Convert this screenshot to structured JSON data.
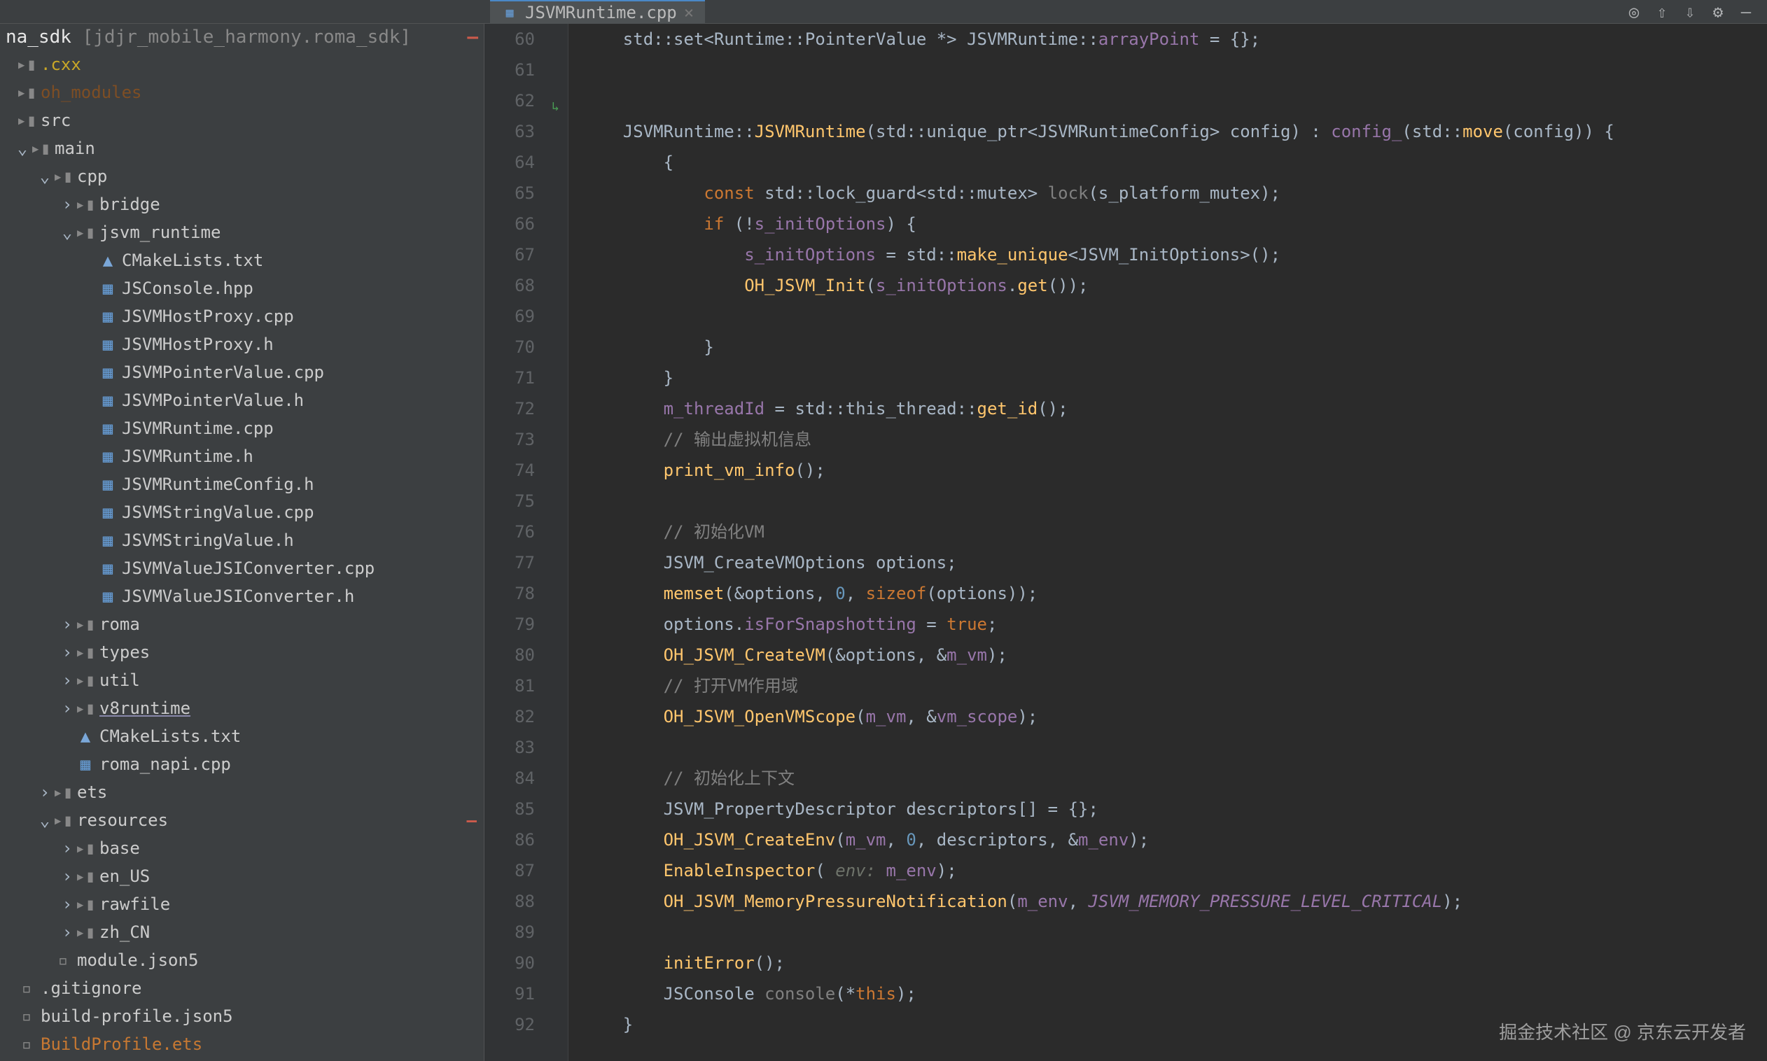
{
  "toolbar": {
    "icons": [
      "target-icon",
      "upload-icon",
      "download-icon",
      "gear-icon",
      "minimize-icon"
    ]
  },
  "tab": {
    "filename": "JSVMRuntime.cpp",
    "icon": "cpp-file-icon"
  },
  "project": {
    "module": "na_sdk",
    "path": "[jdjr_mobile_harmony.roma_sdk]"
  },
  "tree": [
    {
      "label": ".cxx",
      "indent": 0,
      "type": "folder-yellow"
    },
    {
      "label": "oh_modules",
      "indent": 0,
      "type": "folder-orange"
    },
    {
      "label": "src",
      "indent": 0,
      "type": "folder",
      "chevron": ""
    },
    {
      "label": "main",
      "indent": 1,
      "type": "folder",
      "chevron": "v"
    },
    {
      "label": "cpp",
      "indent": 2,
      "type": "folder",
      "chevron": "v"
    },
    {
      "label": "bridge",
      "indent": 3,
      "type": "folder",
      "chevron": ">"
    },
    {
      "label": "jsvm_runtime",
      "indent": 3,
      "type": "folder",
      "chevron": "v"
    },
    {
      "label": "CMakeLists.txt",
      "indent": 4,
      "type": "cmake"
    },
    {
      "label": "JSConsole.hpp",
      "indent": 4,
      "type": "cpp"
    },
    {
      "label": "JSVMHostProxy.cpp",
      "indent": 4,
      "type": "cpp"
    },
    {
      "label": "JSVMHostProxy.h",
      "indent": 4,
      "type": "cpp"
    },
    {
      "label": "JSVMPointerValue.cpp",
      "indent": 4,
      "type": "cpp"
    },
    {
      "label": "JSVMPointerValue.h",
      "indent": 4,
      "type": "cpp"
    },
    {
      "label": "JSVMRuntime.cpp",
      "indent": 4,
      "type": "cpp"
    },
    {
      "label": "JSVMRuntime.h",
      "indent": 4,
      "type": "cpp"
    },
    {
      "label": "JSVMRuntimeConfig.h",
      "indent": 4,
      "type": "cpp"
    },
    {
      "label": "JSVMStringValue.cpp",
      "indent": 4,
      "type": "cpp"
    },
    {
      "label": "JSVMStringValue.h",
      "indent": 4,
      "type": "cpp"
    },
    {
      "label": "JSVMValueJSIConverter.cpp",
      "indent": 4,
      "type": "cpp"
    },
    {
      "label": "JSVMValueJSIConverter.h",
      "indent": 4,
      "type": "cpp"
    },
    {
      "label": "roma",
      "indent": 3,
      "type": "folder",
      "chevron": ">"
    },
    {
      "label": "types",
      "indent": 3,
      "type": "folder",
      "chevron": ">"
    },
    {
      "label": "util",
      "indent": 3,
      "type": "folder",
      "chevron": ">"
    },
    {
      "label": "v8runtime",
      "indent": 3,
      "type": "folder",
      "chevron": ">",
      "v8": true
    },
    {
      "label": "CMakeLists.txt",
      "indent": 3,
      "type": "cmake"
    },
    {
      "label": "roma_napi.cpp",
      "indent": 3,
      "type": "cpp"
    },
    {
      "label": "ets",
      "indent": 2,
      "type": "folder",
      "chevron": ">"
    },
    {
      "label": "resources",
      "indent": 2,
      "type": "folder",
      "chevron": "v",
      "marker": true
    },
    {
      "label": "base",
      "indent": 3,
      "type": "folder",
      "chevron": ">"
    },
    {
      "label": "en_US",
      "indent": 3,
      "type": "folder",
      "chevron": ">"
    },
    {
      "label": "rawfile",
      "indent": 3,
      "type": "folder",
      "chevron": ">"
    },
    {
      "label": "zh_CN",
      "indent": 3,
      "type": "folder",
      "chevron": ">"
    },
    {
      "label": "module.json5",
      "indent": 2,
      "type": "json"
    },
    {
      "label": ".gitignore",
      "indent": 0,
      "type": "file"
    },
    {
      "label": "build-profile.json5",
      "indent": 0,
      "type": "file"
    },
    {
      "label": "BuildProfile.ets",
      "indent": 0,
      "type": "build-orange"
    }
  ],
  "gutter": {
    "start": 60,
    "end": 92
  },
  "code": [
    {
      "n": 60,
      "tokens": [
        {
          "t": "    std::set<Runtime::PointerValue *> JSVMRuntime::",
          "c": "ident"
        },
        {
          "t": "arrayPoint",
          "c": "field"
        },
        {
          "t": " = {};",
          "c": "punct"
        }
      ]
    },
    {
      "n": 61,
      "tokens": []
    },
    {
      "n": 62,
      "tokens": []
    },
    {
      "n": 63,
      "tokens": [
        {
          "t": "    JSVMRuntime::",
          "c": "ident"
        },
        {
          "t": "JSVMRuntime",
          "c": "func"
        },
        {
          "t": "(std::unique_ptr<JSVMRuntimeConfig> config) : ",
          "c": "ident"
        },
        {
          "t": "config_",
          "c": "field"
        },
        {
          "t": "(std::",
          "c": "ident"
        },
        {
          "t": "move",
          "c": "func"
        },
        {
          "t": "(config)) {",
          "c": "ident"
        }
      ]
    },
    {
      "n": 64,
      "tokens": [
        {
          "t": "        {",
          "c": "punct"
        }
      ]
    },
    {
      "n": 65,
      "tokens": [
        {
          "t": "            ",
          "c": "punct"
        },
        {
          "t": "const",
          "c": "kw"
        },
        {
          "t": " std::lock_guard<std::mutex> ",
          "c": "ident"
        },
        {
          "t": "lock",
          "c": "comment"
        },
        {
          "t": "(s_platform_mutex);",
          "c": "ident"
        }
      ]
    },
    {
      "n": 66,
      "tokens": [
        {
          "t": "            ",
          "c": "punct"
        },
        {
          "t": "if",
          "c": "kw"
        },
        {
          "t": " (!",
          "c": "ident"
        },
        {
          "t": "s_initOptions",
          "c": "field"
        },
        {
          "t": ") {",
          "c": "ident"
        }
      ]
    },
    {
      "n": 67,
      "tokens": [
        {
          "t": "                ",
          "c": "punct"
        },
        {
          "t": "s_initOptions",
          "c": "field"
        },
        {
          "t": " = std::",
          "c": "ident"
        },
        {
          "t": "make_unique",
          "c": "func"
        },
        {
          "t": "<JSVM_InitOptions>();",
          "c": "ident"
        }
      ]
    },
    {
      "n": 68,
      "tokens": [
        {
          "t": "                ",
          "c": "punct"
        },
        {
          "t": "OH_JSVM_Init",
          "c": "func"
        },
        {
          "t": "(",
          "c": "ident"
        },
        {
          "t": "s_initOptions",
          "c": "field"
        },
        {
          "t": ".",
          "c": "ident"
        },
        {
          "t": "get",
          "c": "func"
        },
        {
          "t": "());",
          "c": "ident"
        }
      ]
    },
    {
      "n": 69,
      "tokens": []
    },
    {
      "n": 70,
      "tokens": [
        {
          "t": "            }",
          "c": "punct"
        }
      ]
    },
    {
      "n": 71,
      "tokens": [
        {
          "t": "        }",
          "c": "punct"
        }
      ]
    },
    {
      "n": 72,
      "tokens": [
        {
          "t": "        ",
          "c": "punct"
        },
        {
          "t": "m_threadId",
          "c": "field"
        },
        {
          "t": " = std::this_thread::",
          "c": "ident"
        },
        {
          "t": "get_id",
          "c": "func"
        },
        {
          "t": "();",
          "c": "ident"
        }
      ]
    },
    {
      "n": 73,
      "tokens": [
        {
          "t": "        ",
          "c": "punct"
        },
        {
          "t": "// 输出虚拟机信息",
          "c": "comment"
        }
      ]
    },
    {
      "n": 74,
      "tokens": [
        {
          "t": "        ",
          "c": "punct"
        },
        {
          "t": "print_vm_info",
          "c": "func"
        },
        {
          "t": "();",
          "c": "ident"
        }
      ]
    },
    {
      "n": 75,
      "tokens": []
    },
    {
      "n": 76,
      "tokens": [
        {
          "t": "        ",
          "c": "punct"
        },
        {
          "t": "// 初始化VM",
          "c": "comment"
        }
      ]
    },
    {
      "n": 77,
      "tokens": [
        {
          "t": "        JSVM_CreateVMOptions options;",
          "c": "ident"
        }
      ]
    },
    {
      "n": 78,
      "tokens": [
        {
          "t": "        ",
          "c": "punct"
        },
        {
          "t": "memset",
          "c": "func"
        },
        {
          "t": "(&options, ",
          "c": "ident"
        },
        {
          "t": "0",
          "c": "num"
        },
        {
          "t": ", ",
          "c": "ident"
        },
        {
          "t": "sizeof",
          "c": "kw"
        },
        {
          "t": "(options));",
          "c": "ident"
        }
      ]
    },
    {
      "n": 79,
      "tokens": [
        {
          "t": "        options.",
          "c": "ident"
        },
        {
          "t": "isForSnapshotting",
          "c": "field"
        },
        {
          "t": " = ",
          "c": "ident"
        },
        {
          "t": "true",
          "c": "kw"
        },
        {
          "t": ";",
          "c": "ident"
        }
      ]
    },
    {
      "n": 80,
      "tokens": [
        {
          "t": "        ",
          "c": "punct"
        },
        {
          "t": "OH_JSVM_CreateVM",
          "c": "func"
        },
        {
          "t": "(&options, &",
          "c": "ident"
        },
        {
          "t": "m_vm",
          "c": "field"
        },
        {
          "t": ");",
          "c": "ident"
        }
      ]
    },
    {
      "n": 81,
      "tokens": [
        {
          "t": "        ",
          "c": "punct"
        },
        {
          "t": "// 打开VM作用域",
          "c": "comment"
        }
      ]
    },
    {
      "n": 82,
      "tokens": [
        {
          "t": "        ",
          "c": "punct"
        },
        {
          "t": "OH_JSVM_OpenVMScope",
          "c": "func"
        },
        {
          "t": "(",
          "c": "ident"
        },
        {
          "t": "m_vm",
          "c": "field"
        },
        {
          "t": ", &",
          "c": "ident"
        },
        {
          "t": "vm_scope",
          "c": "field"
        },
        {
          "t": ");",
          "c": "ident"
        }
      ]
    },
    {
      "n": 83,
      "tokens": []
    },
    {
      "n": 84,
      "tokens": [
        {
          "t": "        ",
          "c": "punct"
        },
        {
          "t": "// 初始化上下文",
          "c": "comment"
        }
      ]
    },
    {
      "n": 85,
      "tokens": [
        {
          "t": "        JSVM_PropertyDescriptor descriptors[] = {};",
          "c": "ident"
        }
      ]
    },
    {
      "n": 86,
      "tokens": [
        {
          "t": "        ",
          "c": "punct"
        },
        {
          "t": "OH_JSVM_CreateEnv",
          "c": "func"
        },
        {
          "t": "(",
          "c": "ident"
        },
        {
          "t": "m_vm",
          "c": "field"
        },
        {
          "t": ", ",
          "c": "ident"
        },
        {
          "t": "0",
          "c": "num"
        },
        {
          "t": ", descriptors, &",
          "c": "ident"
        },
        {
          "t": "m_env",
          "c": "field"
        },
        {
          "t": ");",
          "c": "ident"
        }
      ]
    },
    {
      "n": 87,
      "tokens": [
        {
          "t": "        ",
          "c": "punct"
        },
        {
          "t": "EnableInspector",
          "c": "func"
        },
        {
          "t": "( ",
          "c": "ident"
        },
        {
          "t": "env:",
          "c": "param"
        },
        {
          "t": " ",
          "c": "ident"
        },
        {
          "t": "m_env",
          "c": "field"
        },
        {
          "t": ");",
          "c": "ident"
        }
      ]
    },
    {
      "n": 88,
      "tokens": [
        {
          "t": "        ",
          "c": "punct"
        },
        {
          "t": "OH_JSVM_MemoryPressureNotification",
          "c": "func"
        },
        {
          "t": "(",
          "c": "ident"
        },
        {
          "t": "m_env",
          "c": "field"
        },
        {
          "t": ", ",
          "c": "ident"
        },
        {
          "t": "JSVM_MEMORY_PRESSURE_LEVEL_CRITICAL",
          "c": "const-it"
        },
        {
          "t": ");",
          "c": "ident"
        }
      ]
    },
    {
      "n": 89,
      "tokens": []
    },
    {
      "n": 90,
      "tokens": [
        {
          "t": "        ",
          "c": "punct"
        },
        {
          "t": "initError",
          "c": "func"
        },
        {
          "t": "();",
          "c": "ident"
        }
      ]
    },
    {
      "n": 91,
      "tokens": [
        {
          "t": "        JSConsole ",
          "c": "ident"
        },
        {
          "t": "console",
          "c": "comment"
        },
        {
          "t": "(*",
          "c": "ident"
        },
        {
          "t": "this",
          "c": "kw"
        },
        {
          "t": ");",
          "c": "ident"
        }
      ]
    },
    {
      "n": 92,
      "tokens": [
        {
          "t": "    }",
          "c": "punct"
        }
      ]
    }
  ],
  "watermark": "掘金技术社区 @ 京东云开发者"
}
